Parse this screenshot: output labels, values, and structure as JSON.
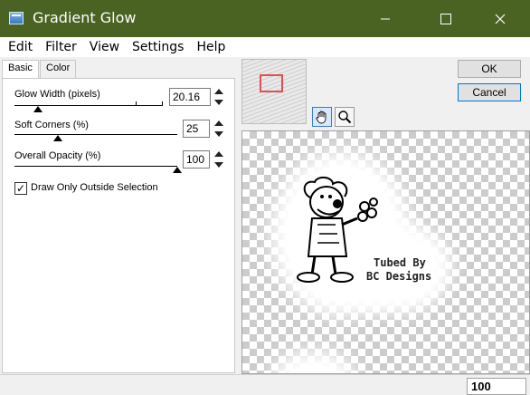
{
  "window": {
    "title": "Gradient Glow"
  },
  "menu": [
    "Edit",
    "Filter",
    "View",
    "Settings",
    "Help"
  ],
  "tabs": [
    "Basic",
    "Color"
  ],
  "params": {
    "glow_width": {
      "label": "Glow Width (pixels)",
      "value": "20.16",
      "position": 0.11
    },
    "soft_corners": {
      "label": "Soft Corners (%)",
      "value": "25",
      "position": 0.25
    },
    "overall_opacity": {
      "label": "Overall Opacity (%)",
      "value": "100",
      "position": 1.0
    }
  },
  "draw_only_outside": {
    "label": "Draw Only Outside Selection",
    "checked": true
  },
  "buttons": {
    "ok": "OK",
    "cancel": "Cancel"
  },
  "preview_text": {
    "line1": "Tubed By",
    "line2": "BC Designs"
  },
  "status": {
    "zoom": "100"
  },
  "colors": {
    "titlebar": "#4a6323",
    "selection_rect": "#e05050",
    "accent": "#0078d7"
  },
  "icons": {
    "pan": "hand-icon",
    "zoom": "magnifier-icon"
  }
}
